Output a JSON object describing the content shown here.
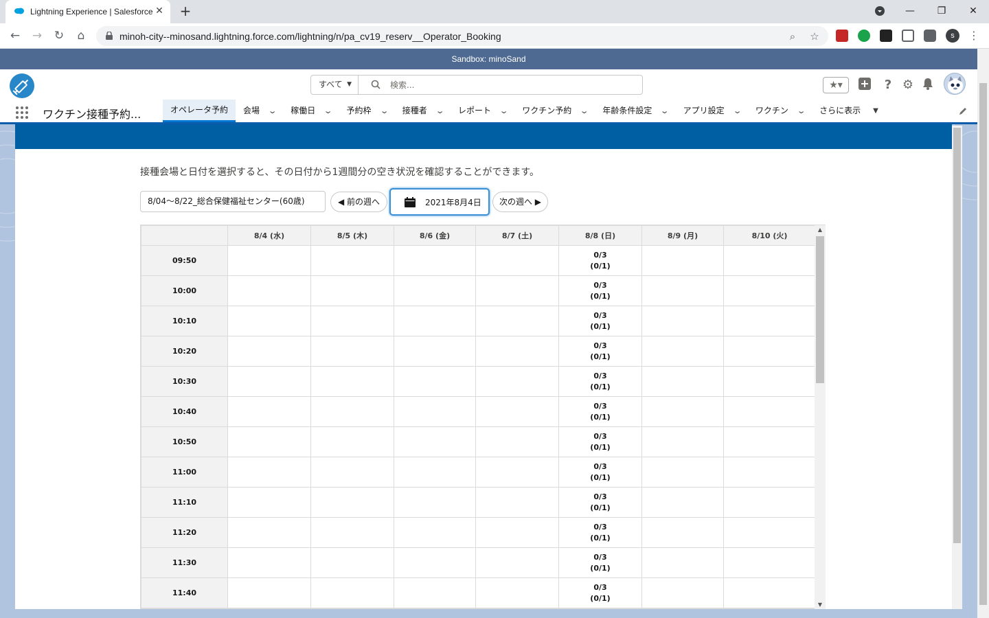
{
  "browser": {
    "tab_title": "Lightning Experience | Salesforce",
    "url": "minoh-city--minosand.lightning.force.com/lightning/n/pa_cv19_reserv__Operator_Booking",
    "profile_initial": "s"
  },
  "sandbox_banner": "Sandbox: minoSand",
  "header": {
    "search_scope": "すべて",
    "search_placeholder": "検索..."
  },
  "nav": {
    "app_name": "ワクチン接種予約...",
    "items": [
      {
        "label": "オペレータ予約",
        "active": true,
        "dropdown": false
      },
      {
        "label": "会場",
        "dropdown": true
      },
      {
        "label": "稼働日",
        "dropdown": true
      },
      {
        "label": "予約枠",
        "dropdown": true
      },
      {
        "label": "接種者",
        "dropdown": true
      },
      {
        "label": "レポート",
        "dropdown": true
      },
      {
        "label": "ワクチン予約",
        "dropdown": true
      },
      {
        "label": "年齢条件設定",
        "dropdown": true
      },
      {
        "label": "アプリ設定",
        "dropdown": true
      },
      {
        "label": "ワクチン",
        "dropdown": true
      }
    ],
    "more_label": "さらに表示"
  },
  "content": {
    "description": "接種会場と日付を選択すると、その日付から1週間分の空き状況を確認することができます。",
    "venue_value": "8/04～8/22_総合保健福祉センター(60歳)",
    "prev_week": "前の週へ",
    "current_date": "2021年8月4日",
    "next_week": "次の週へ"
  },
  "table": {
    "columns": [
      "8/4 (水)",
      "8/5 (木)",
      "8/6 (金)",
      "8/7 (土)",
      "8/8 (日)",
      "8/9 (月)",
      "8/10 (火)"
    ],
    "rows": [
      {
        "time": "09:50",
        "cells": [
          "",
          "",
          "",
          "",
          "0/3\n(0/1)",
          "",
          ""
        ]
      },
      {
        "time": "10:00",
        "cells": [
          "",
          "",
          "",
          "",
          "0/3\n(0/1)",
          "",
          ""
        ]
      },
      {
        "time": "10:10",
        "cells": [
          "",
          "",
          "",
          "",
          "0/3\n(0/1)",
          "",
          ""
        ]
      },
      {
        "time": "10:20",
        "cells": [
          "",
          "",
          "",
          "",
          "0/3\n(0/1)",
          "",
          ""
        ]
      },
      {
        "time": "10:30",
        "cells": [
          "",
          "",
          "",
          "",
          "0/3\n(0/1)",
          "",
          ""
        ]
      },
      {
        "time": "10:40",
        "cells": [
          "",
          "",
          "",
          "",
          "0/3\n(0/1)",
          "",
          ""
        ]
      },
      {
        "time": "10:50",
        "cells": [
          "",
          "",
          "",
          "",
          "0/3\n(0/1)",
          "",
          ""
        ]
      },
      {
        "time": "11:00",
        "cells": [
          "",
          "",
          "",
          "",
          "0/3\n(0/1)",
          "",
          ""
        ]
      },
      {
        "time": "11:10",
        "cells": [
          "",
          "",
          "",
          "",
          "0/3\n(0/1)",
          "",
          ""
        ]
      },
      {
        "time": "11:20",
        "cells": [
          "",
          "",
          "",
          "",
          "0/3\n(0/1)",
          "",
          ""
        ]
      },
      {
        "time": "11:30",
        "cells": [
          "",
          "",
          "",
          "",
          "0/3\n(0/1)",
          "",
          ""
        ]
      },
      {
        "time": "11:40",
        "cells": [
          "",
          "",
          "",
          "",
          "0/3\n(0/1)",
          "",
          ""
        ]
      }
    ]
  },
  "colors": {
    "brand_band": "#005fa2",
    "sandbox_bar": "#4f6a92",
    "active_tab": "#0176d3",
    "date_focus": "#3a8fd5"
  }
}
